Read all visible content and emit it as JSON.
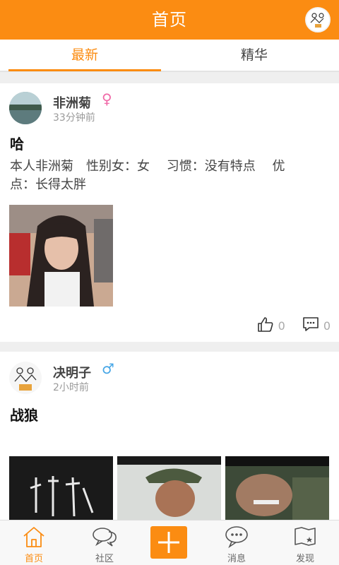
{
  "header": {
    "title": "首页",
    "avatar_icon": "user-avatar-icon"
  },
  "tabs": [
    {
      "label": "最新",
      "active": true
    },
    {
      "label": "精华",
      "active": false
    }
  ],
  "posts": [
    {
      "username": "非洲菊",
      "gender": "♀",
      "time": "33分钟前",
      "title": "哈",
      "body": "本人非洲菊　性别女：女　 习惯：没有特点　 优点：长得太胖",
      "likes": "0",
      "comments": "0"
    },
    {
      "username": "决明子",
      "gender": "♂",
      "time": "2小时前",
      "title": "战狼"
    }
  ],
  "bottom_nav": [
    {
      "label": "首页",
      "active": true
    },
    {
      "label": "社区",
      "active": false
    },
    {
      "label": "",
      "active": false
    },
    {
      "label": "消息",
      "active": false
    },
    {
      "label": "发现",
      "active": false
    }
  ],
  "colors": {
    "accent": "#fb8c12",
    "female": "#f06aa8",
    "male": "#46a6e6"
  }
}
